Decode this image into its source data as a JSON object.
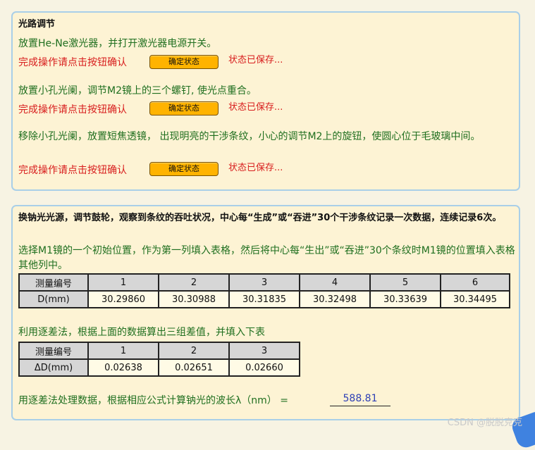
{
  "section1": {
    "title": "光路调节",
    "step1": "放置He-Ne激光器，并打开激光器电源开关。",
    "step2": "放置小孔光阑，调节M2镜上的三个螺钉, 使光点重合。",
    "step3": "移除小孔光阑，放置短焦透镜， 出现明亮的干涉条纹，小心的调节M2上的旋钮，使圆心位于毛玻璃中间。",
    "confirm_text": "完成操作请点击按钮确认",
    "button_label": "确定状态",
    "saved_text": "状态已保存..."
  },
  "section2": {
    "title": "换钠光光源，调节鼓轮，观察到条纹的吞吐状况，中心每“生成”或“吞进”30个干涉条纹记录一次数据，连续记录6次。",
    "instruction": "选择M1镜的一个初始位置，作为第一列填入表格，然后将中心每“生出”或“吞进”30个条纹时M1镜的位置填入表格其他列中。",
    "table1": {
      "header_label": "测量编号",
      "columns": [
        "1",
        "2",
        "3",
        "4",
        "5",
        "6"
      ],
      "row_label": "D(mm)",
      "values": [
        "30.29860",
        "30.30988",
        "30.31835",
        "30.32498",
        "30.33639",
        "30.34495"
      ]
    },
    "diff_instruction": "利用逐差法，根据上面的数据算出三组差值，并填入下表",
    "table2": {
      "header_label": "测量编号",
      "columns": [
        "1",
        "2",
        "3"
      ],
      "row_label": "ΔD(mm)",
      "values": [
        "0.02638",
        "0.02651",
        "0.02660"
      ]
    },
    "wavelength_label": "用逐差法处理数据，根据相应公式计算钠光的波长λ（nm） =",
    "wavelength_value": "588.81"
  },
  "watermark": "CSDN @脱脱克克",
  "colors": {
    "panel_bg": "#fdf3d4",
    "panel_border": "#a9cfe8",
    "green_text": "#1f6f1f",
    "red_text": "#d81d1d",
    "button_bg": "#ffb300",
    "answer_blue": "#2d3fb5"
  }
}
